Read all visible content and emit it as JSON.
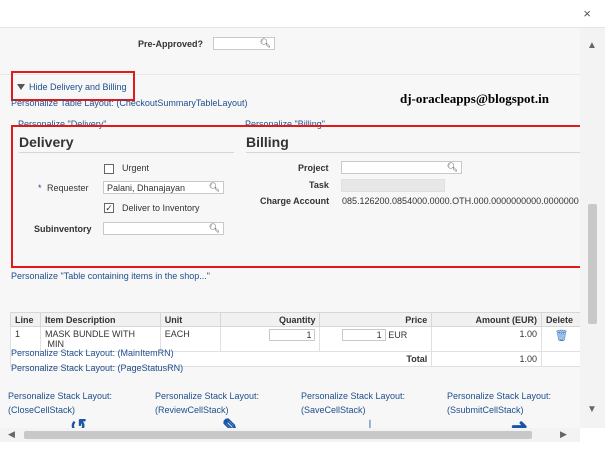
{
  "window": {
    "close": "×"
  },
  "preapproved": {
    "label": "Pre-Approved?"
  },
  "hide_link": "Hide Delivery and Billing",
  "personalize_table_layout": "Personalize Table Layout: (CheckoutSummaryTableLayout)",
  "watermark": "dj-oracleapps@blogspot.in",
  "personalize_delivery": "Personalize \"Delivery\"",
  "personalize_billing": "Personalize \"Billing\"",
  "delivery": {
    "title": "Delivery",
    "urgent_label": "Urgent",
    "requester_label": "Requester",
    "requester_value": "Palani, Dhanajayan",
    "deliver_label": "Deliver to Inventory",
    "subinventory_label": "Subinventory"
  },
  "billing": {
    "title": "Billing",
    "project_label": "Project",
    "task_label": "Task",
    "charge_label": "Charge Account",
    "charge_value": "085.126200.0854000.0000.OTH.000.0000000000.0000000"
  },
  "personalize_items": "Personalize \"Table containing items in the shop...\"",
  "table": {
    "headers": [
      "Line",
      "Item Description",
      "Unit",
      "Quantity",
      "Price",
      "Amount (EUR)",
      "Delete"
    ],
    "row": {
      "line": "1",
      "desc1": "MASK BUNDLE WITH",
      "desc2": "MIN",
      "unit": "EACH",
      "qty": "1",
      "price": "1",
      "currency": "EUR",
      "amount": "1.00"
    },
    "total_label": "Total",
    "total_value": "1.00"
  },
  "personalize_main": "Personalize Stack Layout: (MainItemRN)",
  "personalize_page": "Personalize Stack Layout: (PageStatusRN)",
  "stacks": [
    {
      "line1": "Personalize Stack Layout:",
      "line2": "(CloseCellStack)"
    },
    {
      "line1": "Personalize Stack Layout:",
      "line2": "(ReviewCellStack)"
    },
    {
      "line1": "Personalize Stack Layout:",
      "line2": "(SaveCellStack)"
    },
    {
      "line1": "Personalize Stack Layout:",
      "line2": "(SsubmitCellStack)"
    }
  ],
  "colors": {
    "accent": "#1f4e8c",
    "highlight": "#e01919"
  }
}
